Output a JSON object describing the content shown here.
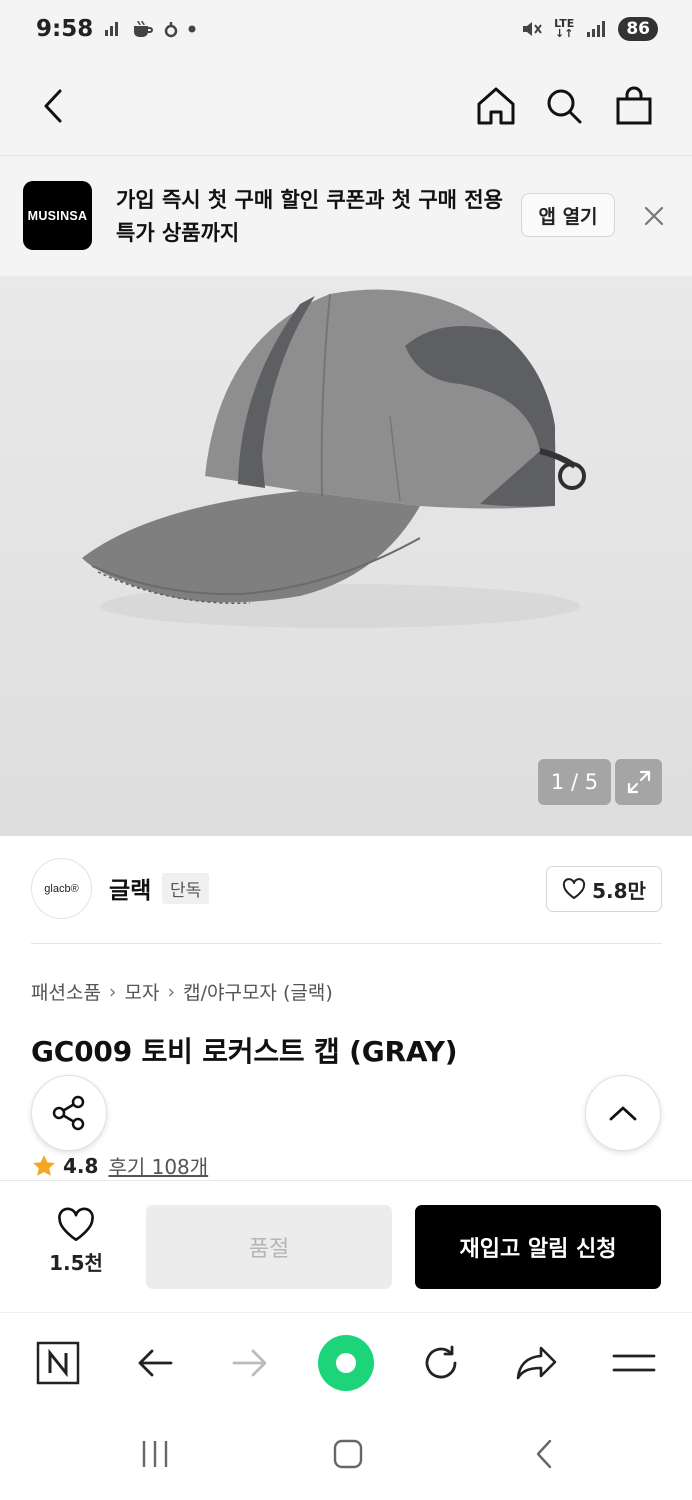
{
  "status_bar": {
    "time": "9:58",
    "network": "LTE",
    "battery": "86"
  },
  "nav": {
    "back": "back",
    "home": "home",
    "search": "search",
    "cart": "shopping-bag"
  },
  "banner": {
    "logo_text": "MUSINSA",
    "message": "가입 즉시 첫 구매 할인 쿠폰과 첫 구매 전용 특가 상품까지",
    "open_app_label": "앱 열기"
  },
  "gallery": {
    "counter": "1 / 5"
  },
  "brand": {
    "logo_text": "glacb®",
    "name": "글랙",
    "tag": "단독",
    "likes": "5.8만"
  },
  "breadcrumb": [
    "패션소품",
    "모자",
    "캡/야구모자 (글랙)"
  ],
  "product": {
    "title": "GC009 토비 로커스트 캡 (GRAY)",
    "rating": "4.8",
    "reviews": "후기 108개"
  },
  "purchase": {
    "wish_count": "1.5천",
    "soldout_label": "품절",
    "restock_label": "재입고 알림 신청"
  },
  "colors": {
    "accent": "#000000",
    "star": "#f5a623",
    "browser_home": "#1ed47a"
  }
}
